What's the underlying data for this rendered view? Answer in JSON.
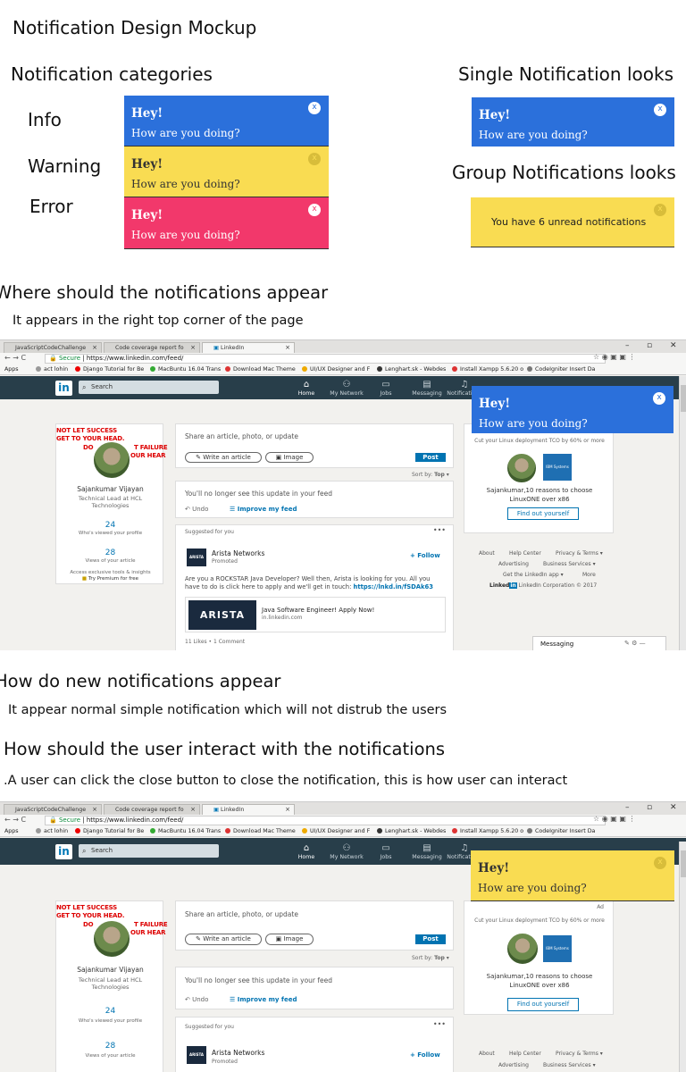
{
  "page_title": "Notification Design Mockup",
  "categories_heading": "Notification categories",
  "single_heading": "Single Notification looks",
  "group_heading": "Group Notifications looks",
  "categories": {
    "info": "Info",
    "warning": "Warning",
    "error": "Error"
  },
  "notification": {
    "title": "Hey!",
    "message": "How are you doing?",
    "close": "x"
  },
  "group_notification": {
    "message": "You have 6 unread notifications",
    "close": "x"
  },
  "colors": {
    "info": "#2b70db",
    "warning": "#f9dc52",
    "error": "#f2386b"
  },
  "sections": {
    "where_heading": "Where should the notifications appear",
    "where_text": "It appears in the right top corner of the page",
    "new_heading": "How do new notifications appear",
    "new_text": "It appear normal simple notification which will not distrub the users",
    "interact_heading": "How should the user interact with the notifications",
    "interact_text": ".A user can click the close button to close the notification, this is how user can interact"
  },
  "browser": {
    "tabs": [
      "JavaScriptCodeChallenge",
      "Code coverage report fo",
      "LinkedIn"
    ],
    "url_secure": "Secure",
    "url": "https://www.linkedin.com/feed/",
    "bookmarks": [
      {
        "label": "Apps"
      },
      {
        "label": "act lohin"
      },
      {
        "label": "Django Tutorial for Be"
      },
      {
        "label": "MacBuntu 16.04 Trans"
      },
      {
        "label": "Download Mac Theme"
      },
      {
        "label": "UI/UX Designer and F"
      },
      {
        "label": "Lenghart.sk - Webdes"
      },
      {
        "label": "Install Xampp 5.6.20 o"
      },
      {
        "label": "CodeIgniter Insert Da"
      }
    ]
  },
  "linkedin": {
    "logo": "in",
    "search_placeholder": "Search",
    "nav": [
      "Home",
      "My Network",
      "Jobs",
      "Messaging",
      "Notifications"
    ],
    "poster_line1": "NOT LET SUCCESS",
    "poster_line2": "GET TO YOUR HEAD.",
    "poster_line3": "DO",
    "poster_line4": "T FAILURE",
    "poster_line5": "OUR HEAR",
    "profile_name": "Sajankumar Vijayan",
    "profile_title_1": "Technical Lead at HCL",
    "profile_title_2": "Technologies",
    "views_count": "24",
    "views_label": "Who's viewed your profile",
    "article_count": "28",
    "article_label": "Views of your article",
    "premium_line1": "Access exclusive tools & insights",
    "premium_line2": "Try Premium for free",
    "share_prompt": "Share an article, photo, or update",
    "write_article": "Write an article",
    "image_btn": "Image",
    "post_btn": "Post",
    "sort_by": "Sort by:",
    "sort_value": "Top",
    "hidden_update": "You'll no longer see this update in your feed",
    "undo": "Undo",
    "improve_feed": "Improve my feed",
    "suggested": "Suggested for you",
    "company": "Arista Networks",
    "promoted": "Promoted",
    "follow": "+ Follow",
    "ad_text_1": "Are you a ROCKSTAR Java Developer? Well then, Arista is looking for you. All you",
    "ad_text_2": "have to do is click here to apply and we'll get in touch:",
    "ad_link": "https://lnkd.in/fSDAk63",
    "arista_logo": "ARISTA",
    "job_title": "Java Software Engineer! Apply Now!",
    "job_domain": "in.linkedin.com",
    "likes": "11 Likes • 1 Comment",
    "ad_label": "Ad",
    "ad_tagline": "Cut your Linux deployment TCO by 60% or more",
    "ibm_label": "IBM Systems",
    "ad_person_1": "Sajankumar,10 reasons to choose",
    "ad_person_2": "LinuxONE over x86",
    "find_out": "Find out yourself",
    "footer_about": "About",
    "footer_help": "Help Center",
    "footer_privacy": "Privacy & Terms",
    "footer_advertising": "Advertising",
    "footer_business": "Business Services",
    "footer_app": "Get the LinkedIn app",
    "footer_more": "More",
    "footer_corp": "LinkedIn Corporation © 2017",
    "messaging": "Messaging"
  }
}
